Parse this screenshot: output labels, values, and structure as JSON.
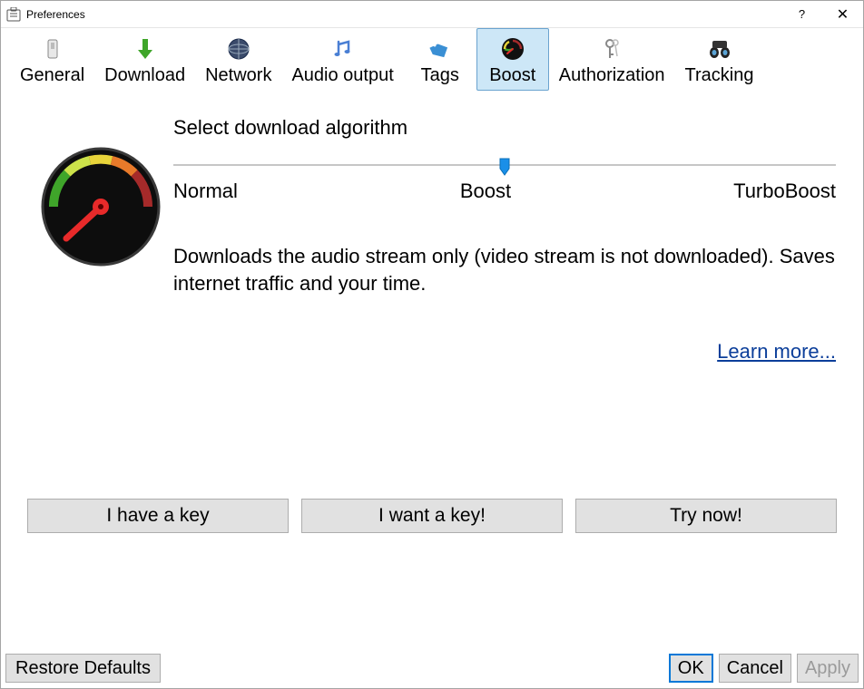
{
  "window": {
    "title": "Preferences"
  },
  "tabs": [
    {
      "label": "General"
    },
    {
      "label": "Download"
    },
    {
      "label": "Network"
    },
    {
      "label": "Audio output"
    },
    {
      "label": "Tags"
    },
    {
      "label": "Boost"
    },
    {
      "label": "Authorization"
    },
    {
      "label": "Tracking"
    }
  ],
  "boost": {
    "heading": "Select download algorithm",
    "slider_labels": {
      "left": "Normal",
      "mid": "Boost",
      "right": "TurboBoost"
    },
    "description": "Downloads the audio stream only (video stream is not downloaded). Saves internet traffic and your time.",
    "learn_more": "Learn more..."
  },
  "key_buttons": {
    "have": "I have a key",
    "want": "I want a key!",
    "try": "Try now!"
  },
  "footer": {
    "restore": "Restore Defaults",
    "ok": "OK",
    "cancel": "Cancel",
    "apply": "Apply"
  }
}
